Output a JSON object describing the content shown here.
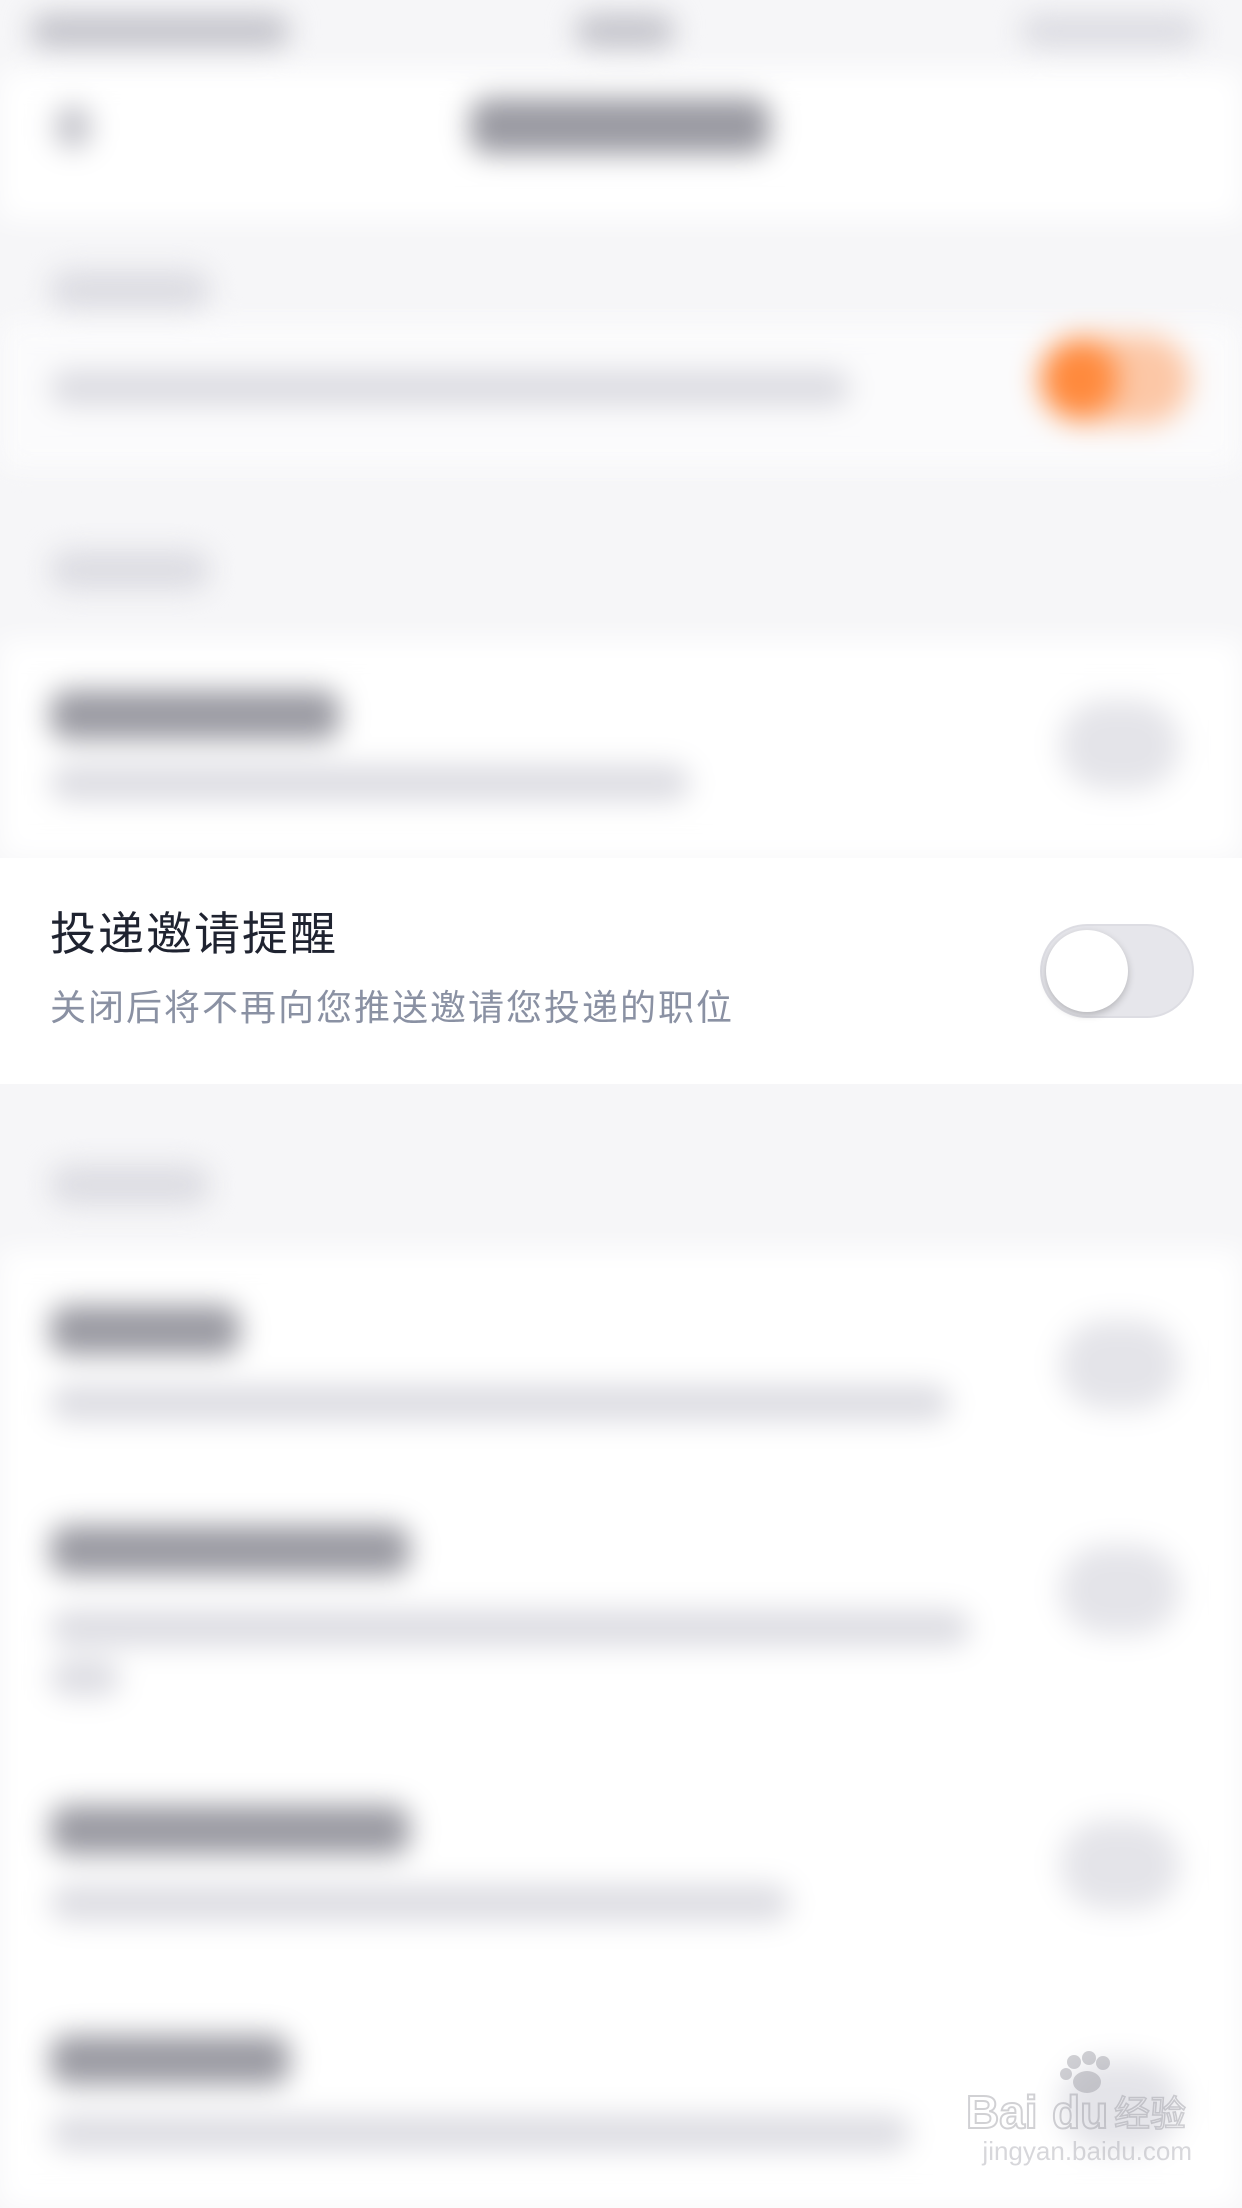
{
  "focused_setting": {
    "title": "投递邀请提醒",
    "description": "关闭后将不再向您推送邀请您投递的职位",
    "toggle_on": false
  },
  "colors": {
    "background": "#f6f6f8",
    "title_text": "#1f2330",
    "description_text": "#8a91a3",
    "toggle_off_track": "#e6e6eb",
    "toggle_on_accent": "#ff8a3d"
  },
  "watermark": {
    "brand": "Baidu经验",
    "url": "jingyan.baidu.com"
  }
}
